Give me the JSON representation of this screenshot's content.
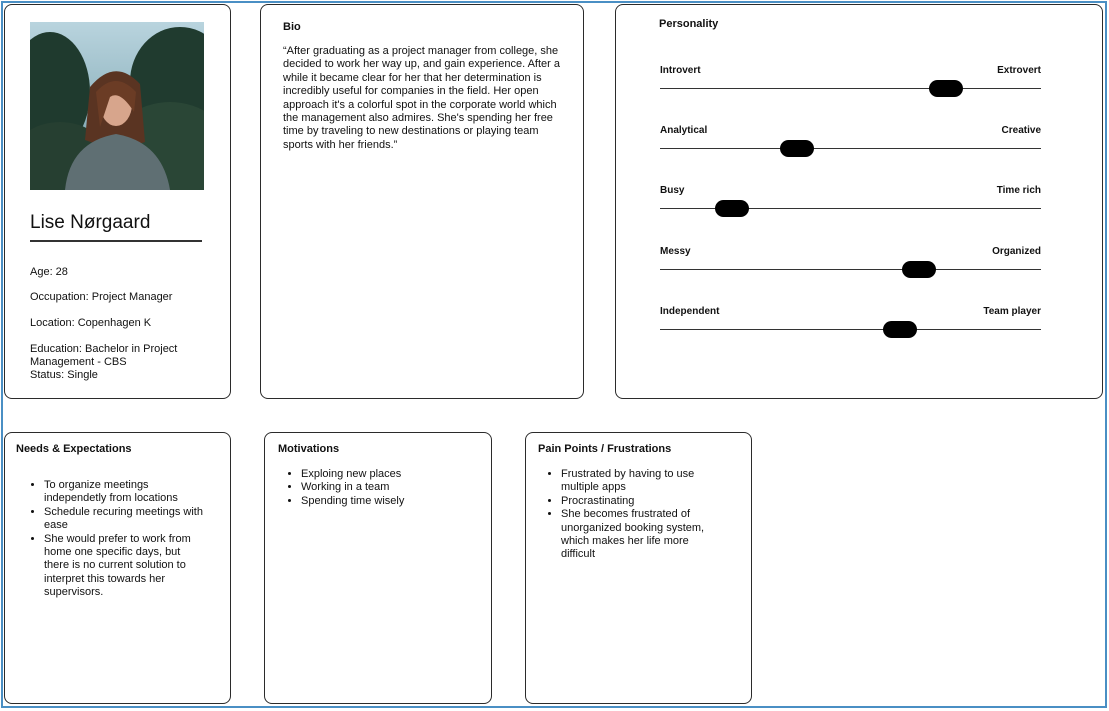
{
  "profile": {
    "photo_alt": "portrait photo",
    "name": "Lise Nørgaard",
    "age": "Age: 28",
    "occupation": "Occupation: Project Manager",
    "location": "Location: Copenhagen K",
    "education": "Education: Bachelor in Project Management - CBS",
    "status": "Status: Single"
  },
  "bio": {
    "title": "Bio",
    "text": "“After graduating as a project manager from college, she decided to work her way up, and gain experience. After a while it became clear for her that her determination is incredibly useful for companies in the field. Her open approach it's a colorful spot in the corporate world which the management also admires. She's spending her free time by traveling to new destinations or playing team sports with her friends.”"
  },
  "personality": {
    "title": "Personality",
    "traits": [
      {
        "left": "Introvert",
        "right": "Extrovert",
        "value": 0.75
      },
      {
        "left": "Analytical",
        "right": "Creative",
        "value": 0.36
      },
      {
        "left": "Busy",
        "right": "Time rich",
        "value": 0.19
      },
      {
        "left": "Messy",
        "right": "Organized",
        "value": 0.68
      },
      {
        "left": "Independent",
        "right": "Team player",
        "value": 0.63
      }
    ]
  },
  "needs": {
    "title": "Needs & Expectations",
    "items": [
      "To organize meetings independetly from locations",
      "Schedule recuring meetings with ease",
      "She would prefer to work from home one specific days, but there is no current solution to interpret this towards her supervisors."
    ]
  },
  "motivations": {
    "title": "Motivations",
    "items": [
      "Exploing new places",
      "Working in a team",
      "Spending time wisely"
    ]
  },
  "pain_points": {
    "title": "Pain Points / Frustrations",
    "items": [
      "Frustrated by having to use multiple apps",
      "Procrastinating",
      "She becomes frustrated of unorganized booking system, which makes her life more difficult"
    ]
  }
}
